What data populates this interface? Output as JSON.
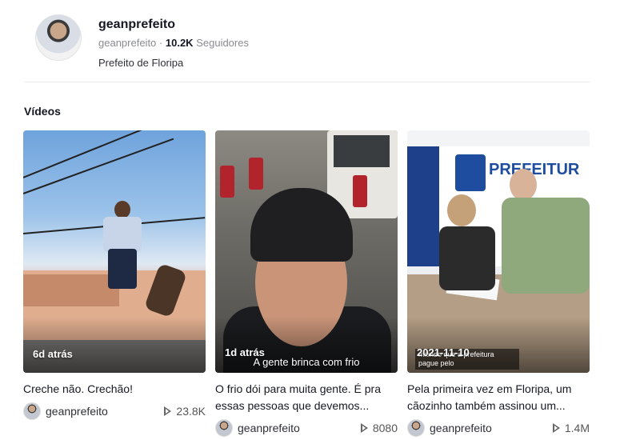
{
  "profile": {
    "name": "geanprefeito",
    "handle": "geanprefeito",
    "separator": "·",
    "followers_count": "10.2K",
    "followers_label": "Seguidores",
    "bio": "Prefeito de Floripa"
  },
  "section_title": "Vídeos",
  "videos": [
    {
      "date": "6d atrás",
      "overlay_caption": "",
      "description": "Creche não. Crechão!",
      "author": "geanprefeito",
      "views": "23.8K"
    },
    {
      "date": "1d atrás",
      "overlay_caption": "A gente brinca com frio",
      "description": "O frio dói para muita gente. É pra essas pessoas que devemos...",
      "author": "geanprefeito",
      "views": "8080"
    },
    {
      "date": "2021-11-10",
      "overlay_caption": "mitindo que a prefeitura pague pelo",
      "banner_text": "PREFEITUR",
      "description": "Pela primeira vez em Floripa, um cãozinho também assinou um...",
      "author": "geanprefeito",
      "views": "1.4M"
    }
  ],
  "icons": {
    "avatar": "avatar",
    "play": "play-icon"
  }
}
